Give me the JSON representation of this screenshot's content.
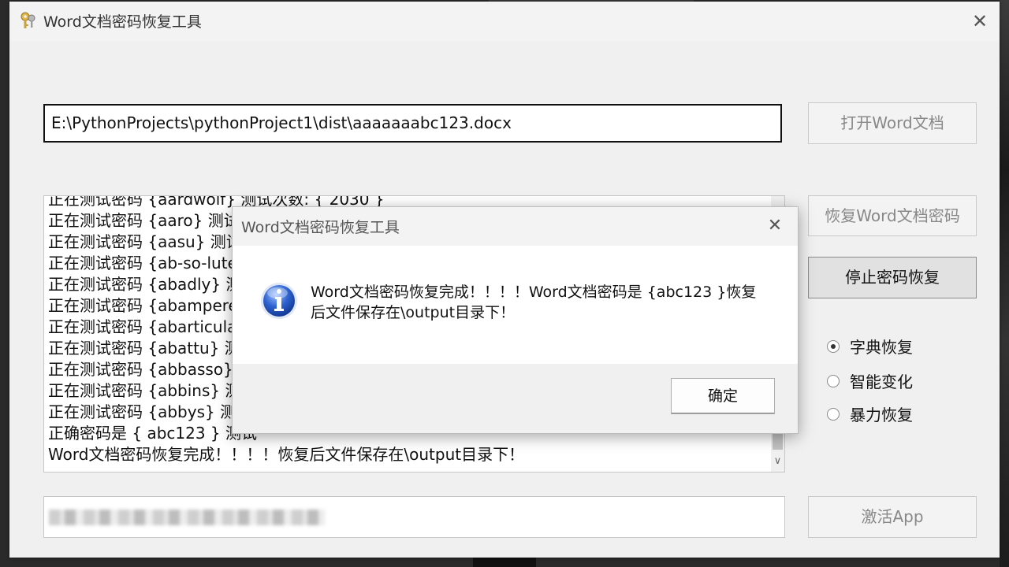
{
  "window": {
    "title": "Word文档密码恢复工具",
    "close_glyph": "✕"
  },
  "file_path": "E:\\PythonProjects\\pythonProject1\\dist\\aaaaaaabc123.docx",
  "buttons": {
    "open": "打开Word文档",
    "recover": "恢复Word文档密码",
    "stop": "停止密码恢复",
    "activate": "激活App"
  },
  "log": {
    "lines": [
      "正在测试密码 {aardwolf} 测试次数: { 2030 }",
      "正在测试密码 {aaro}  测试次数: { 2030 }",
      "正在测试密码 {aasu}  测试次数",
      "正在测试密码 {ab-so-lute}",
      "正在测试密码 {abadly}  测试",
      "正在测试密码 {abamperes}",
      "正在测试密码 {abarticulation}",
      "正在测试密码 {abattu}  测试",
      "正在测试密码 {abbasso}  测",
      "正在测试密码 {abbins}  测试",
      "正在测试密码 {abbys}  测试",
      "正确密码是 { abc123 }  测试",
      "Word文档密码恢复完成！！！！恢复后文件保存在\\output目录下！"
    ]
  },
  "modes": [
    {
      "label": "字典恢复",
      "selected": true
    },
    {
      "label": "智能变化",
      "selected": false
    },
    {
      "label": "暴力恢复",
      "selected": false
    }
  ],
  "dialog": {
    "title": "Word文档密码恢复工具",
    "message": "Word文档密码恢复完成！！！！Word文档密码是 {abc123 }恢复后文件保存在\\output目录下！",
    "ok": "确定",
    "icon": "info-icon",
    "close_glyph": "✕"
  },
  "colors": {
    "window_bg": "#f0f0f0",
    "dialog_body": "#ffffff",
    "info_blue": "#1f4fb5"
  }
}
